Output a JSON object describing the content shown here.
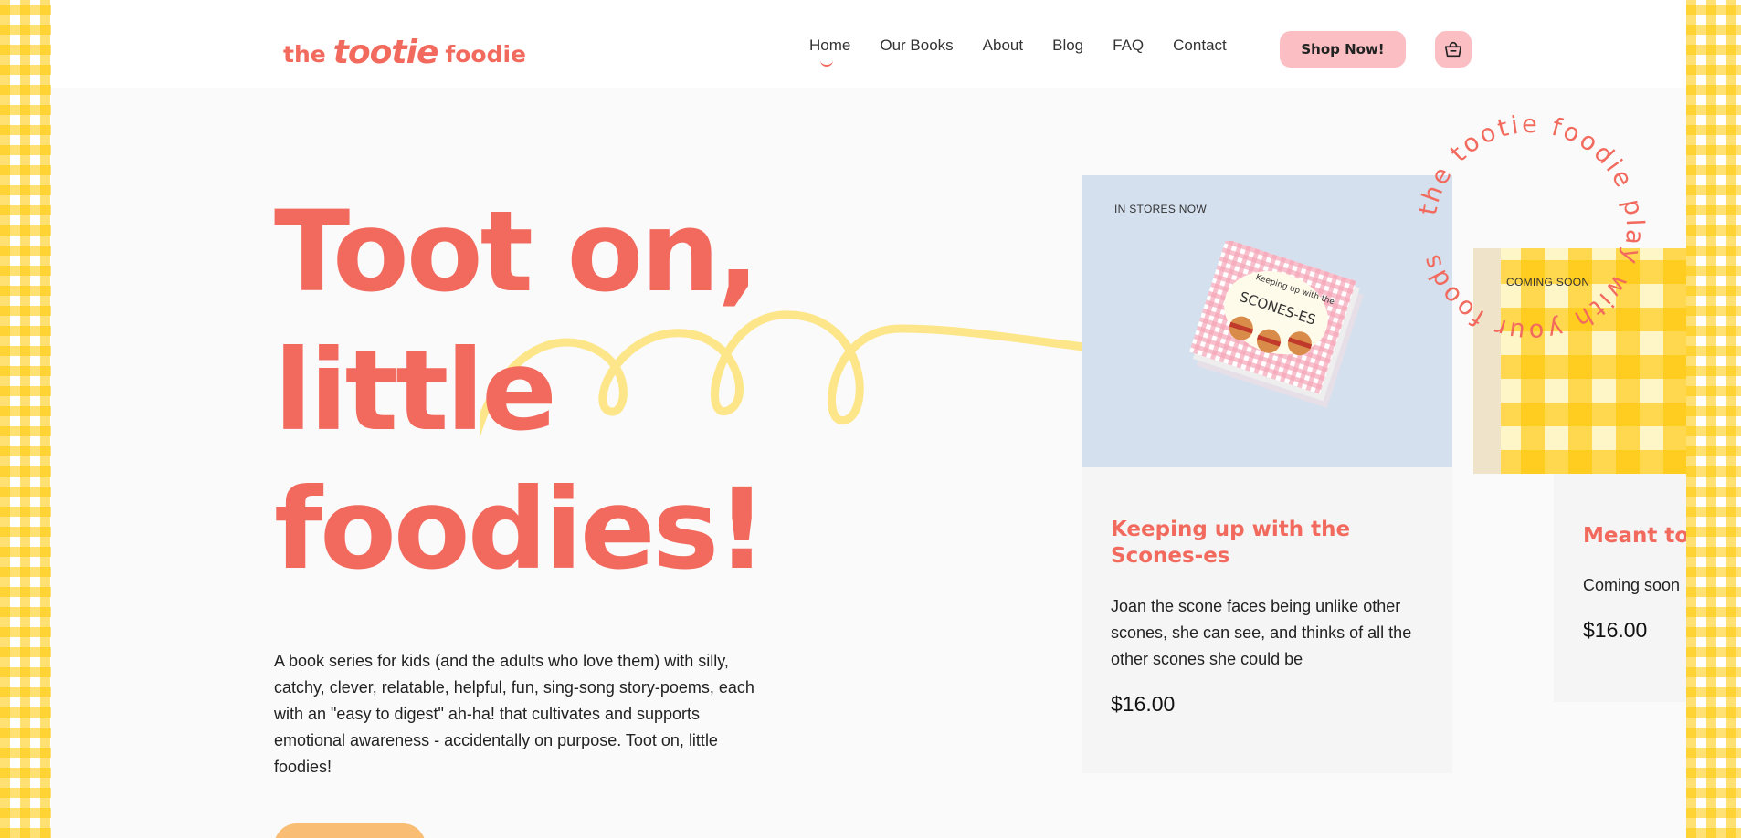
{
  "brand": {
    "logo_the": "the",
    "logo_tootie": "tootie",
    "logo_foodie": "foodie"
  },
  "nav": {
    "items": [
      {
        "label": "Home",
        "active": true
      },
      {
        "label": "Our Books",
        "active": false
      },
      {
        "label": "About",
        "active": false
      },
      {
        "label": "Blog",
        "active": false
      },
      {
        "label": "FAQ",
        "active": false
      },
      {
        "label": "Contact",
        "active": false
      }
    ],
    "shop_label": "Shop Now!",
    "cart_icon": "basket-icon"
  },
  "hero": {
    "title_lines": [
      "Toot on,",
      "little",
      "foodies!"
    ],
    "description": "A book series for kids (and the adults who love them) with silly, catchy, clever, relatable, helpful, fun, sing-song story-poems, each with an \"easy to digest\" ah-ha! that cultivates and supports emotional awareness - accidentally on purpose. Toot on, little foodies!"
  },
  "circle_badge": "the tootie foodie play with your foods",
  "books": [
    {
      "tag": "IN STORES NOW",
      "title": "Keeping up with the Scones-es",
      "description": "Joan the scone faces being unlike other scones, she can see, and thinks of all the other scones she could be",
      "price": "$16.00",
      "cover_text_top": "Keeping up with the",
      "cover_text_main": "SCONES-ES"
    },
    {
      "tag": "COMING SOON",
      "title": "Meant to",
      "description": "Coming soon",
      "price": "$16.00"
    }
  ],
  "colors": {
    "accent": "#f26a5e",
    "button_pink": "#fbbfc3",
    "squiggle_yellow": "#fde68a",
    "gingham_yellow": "#ffc800"
  }
}
